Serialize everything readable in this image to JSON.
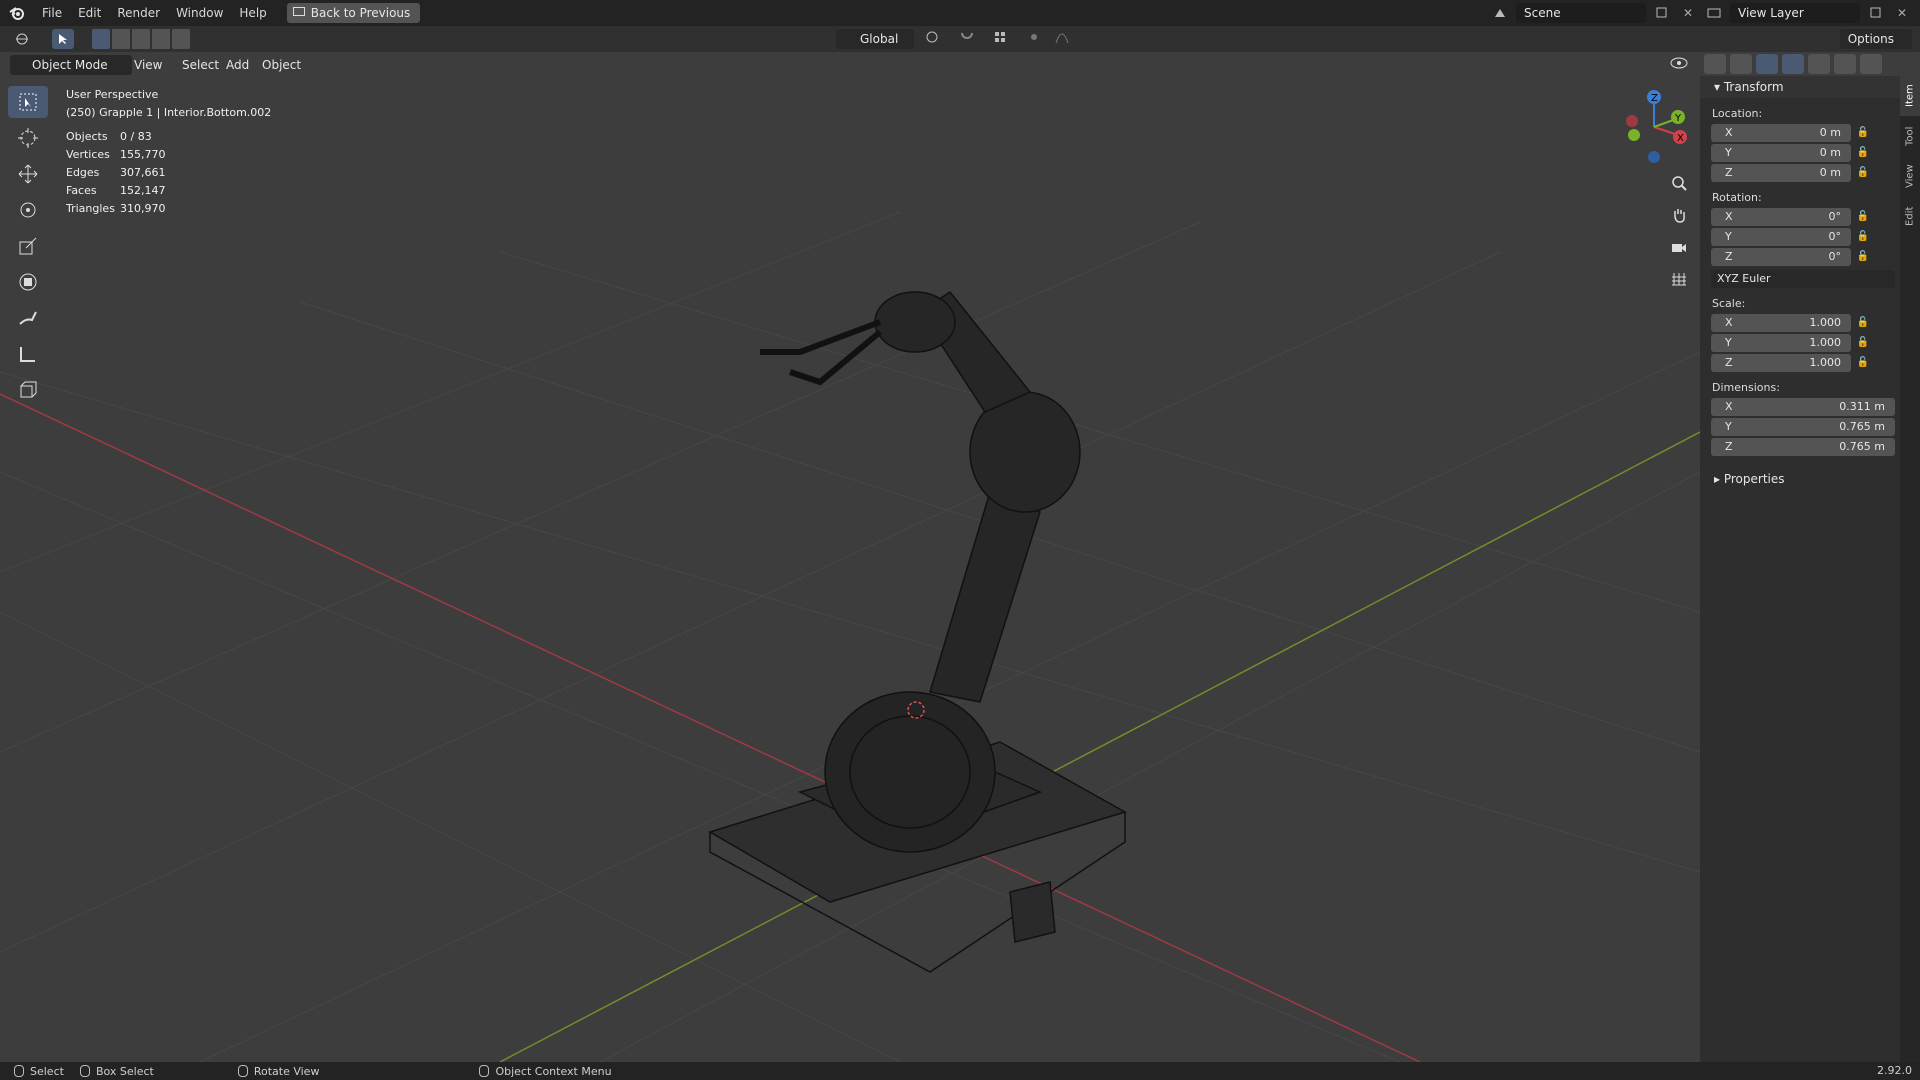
{
  "menu": {
    "items": [
      "File",
      "Edit",
      "Render",
      "Window",
      "Help"
    ],
    "back_button": "Back to Previous",
    "scene": "Scene",
    "view_layer": "View Layer"
  },
  "header": {
    "mode": "Object Mode",
    "menus": [
      "View",
      "Select",
      "Add",
      "Object"
    ],
    "orientation": "Global",
    "options": "Options"
  },
  "viewport": {
    "view_name": "User Perspective",
    "object_info": "(250) Grapple 1 | Interior.Bottom.002",
    "stats": [
      {
        "k": "Objects",
        "v": "0 / 83"
      },
      {
        "k": "Vertices",
        "v": "155,770"
      },
      {
        "k": "Edges",
        "v": "307,661"
      },
      {
        "k": "Faces",
        "v": "152,147"
      },
      {
        "k": "Triangles",
        "v": "310,970"
      }
    ],
    "gizmo": {
      "x": "X",
      "y": "Y",
      "z": "Z"
    }
  },
  "npanel": {
    "transform_title": "Transform",
    "location_label": "Location:",
    "location": [
      {
        "axis": "X",
        "value": "0 m"
      },
      {
        "axis": "Y",
        "value": "0 m"
      },
      {
        "axis": "Z",
        "value": "0 m"
      }
    ],
    "rotation_label": "Rotation:",
    "rotation": [
      {
        "axis": "X",
        "value": "0°"
      },
      {
        "axis": "Y",
        "value": "0°"
      },
      {
        "axis": "Z",
        "value": "0°"
      }
    ],
    "rotation_mode": "XYZ Euler",
    "scale_label": "Scale:",
    "scale": [
      {
        "axis": "X",
        "value": "1.000"
      },
      {
        "axis": "Y",
        "value": "1.000"
      },
      {
        "axis": "Z",
        "value": "1.000"
      }
    ],
    "dimensions_label": "Dimensions:",
    "dimensions": [
      {
        "axis": "X",
        "value": "0.311 m"
      },
      {
        "axis": "Y",
        "value": "0.765 m"
      },
      {
        "axis": "Z",
        "value": "0.765 m"
      }
    ],
    "properties_title": "Properties",
    "tabs": [
      "Item",
      "Tool",
      "View",
      "Edit"
    ]
  },
  "statusbar": {
    "select": "Select",
    "box_select": "Box Select",
    "rotate_view": "Rotate View",
    "context_menu": "Object Context Menu",
    "version": "2.92.0"
  },
  "colors": {
    "x_axis": "#d4404a",
    "y_axis": "#7ab32a",
    "z_axis": "#3b7fd6",
    "active_tool": "#4a5a73"
  }
}
